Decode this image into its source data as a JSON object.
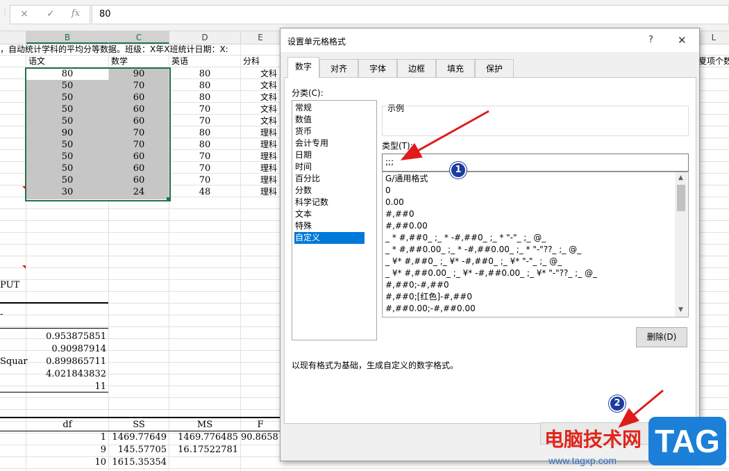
{
  "formula_bar": {
    "cancel_icon": "×",
    "enter_icon": "✓",
    "fx_label": "fx",
    "value": "80"
  },
  "columns": [
    "B",
    "C",
    "D",
    "E",
    "L"
  ],
  "sheet": {
    "row_title": "，自动统计学科的平均分等数据。班级：X年X班统计日期：X:",
    "row_title_right": "夏项个数",
    "headers": [
      "语文",
      "数学",
      "英语",
      "分科"
    ],
    "rows": [
      [
        "80",
        "90",
        "80",
        "文科"
      ],
      [
        "50",
        "70",
        "80",
        "文科"
      ],
      [
        "50",
        "60",
        "80",
        "文科"
      ],
      [
        "50",
        "60",
        "70",
        "文科"
      ],
      [
        "50",
        "60",
        "70",
        "文科"
      ],
      [
        "90",
        "70",
        "80",
        "理科"
      ],
      [
        "50",
        "70",
        "80",
        "理科"
      ],
      [
        "50",
        "60",
        "70",
        "理科"
      ],
      [
        "50",
        "60",
        "70",
        "理科"
      ],
      [
        "50",
        "60",
        "70",
        "理科"
      ],
      [
        "30",
        "24",
        "48",
        "理科"
      ]
    ],
    "output_label": "PUT",
    "dash": "-",
    "stats": [
      "0.953875851",
      "0.90987914",
      "0.899865711",
      "4.021843832",
      "11"
    ],
    "squar_label": "Squar",
    "anova_headers": [
      "df",
      "SS",
      "MS",
      "F"
    ],
    "anova_rows": [
      [
        "1",
        "1469.77649",
        "1469.776485",
        "90.8658"
      ],
      [
        "9",
        "145.57705",
        "16.17522781",
        ""
      ],
      [
        "10",
        "1615.35354",
        "",
        ""
      ]
    ]
  },
  "dialog": {
    "title": "设置单元格格式",
    "help": "?",
    "close": "✕",
    "tabs": [
      "数字",
      "对齐",
      "字体",
      "边框",
      "填充",
      "保护"
    ],
    "category_label": "分类(C):",
    "categories": [
      "常规",
      "数值",
      "货币",
      "会计专用",
      "日期",
      "时间",
      "百分比",
      "分数",
      "科学记数",
      "文本",
      "特殊",
      "自定义"
    ],
    "selected_category": "自定义",
    "sample_label": "示例",
    "type_label": "类型(T):",
    "type_value": ";;;",
    "formats": [
      "G/通用格式",
      "0",
      "0.00",
      "#,##0",
      "#,##0.00",
      "_ * #,##0_ ;_ * -#,##0_ ;_ * \"-\"_ ;_ @_",
      "_ * #,##0.00_ ;_ * -#,##0.00_ ;_ * \"-\"??_ ;_ @_",
      "_ ¥* #,##0_ ;_ ¥* -#,##0_ ;_ ¥* \"-\"_ ;_ @_",
      "_ ¥* #,##0.00_ ;_ ¥* -#,##0.00_ ;_ ¥* \"-\"??_ ;_ @_",
      "#,##0;-#,##0",
      "#,##0;[红色]-#,##0",
      "#,##0.00;-#,##0.00"
    ],
    "delete_button": "删除(D)",
    "description": "以现有格式为基础，生成自定义的数字格式。",
    "annotations": [
      "1",
      "2"
    ]
  },
  "watermark": {
    "text": "电脑技术网",
    "url": "www.tagxp.com",
    "badge": "TAG"
  },
  "colors": {
    "selection": "#c6c6c6",
    "excel_green": "#217346",
    "list_highlight": "#0078d7",
    "arrow": "#e01b1b"
  }
}
